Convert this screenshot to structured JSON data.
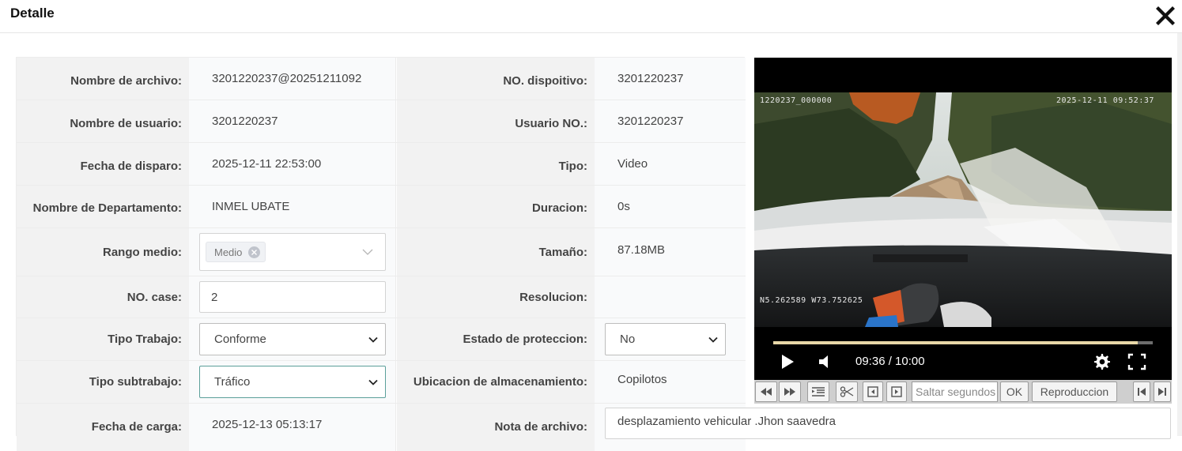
{
  "dialog": {
    "title": "Detalle"
  },
  "fields": {
    "nombre_archivo": {
      "label": "Nombre de archivo:",
      "value": "3201220237@20251211092"
    },
    "no_dispositivo": {
      "label": "NO. dispoitivo:",
      "value": "3201220237"
    },
    "nombre_usuario": {
      "label": "Nombre de usuario:",
      "value": "3201220237"
    },
    "usuario_no": {
      "label": "Usuario NO.:",
      "value": "3201220237"
    },
    "fecha_disparo": {
      "label": "Fecha de disparo:",
      "value": "2025-12-11 22:53:00"
    },
    "tipo": {
      "label": "Tipo:",
      "value": "Video"
    },
    "departamento": {
      "label": "Nombre de Departamento:",
      "value": "INMEL UBATE"
    },
    "duracion": {
      "label": "Duracion:",
      "value": "0s"
    },
    "rango_medio": {
      "label": "Rango medio:",
      "tag": "Medio"
    },
    "tamano": {
      "label": "Tamaño:",
      "value": "87.18MB"
    },
    "no_case": {
      "label": "NO. case:",
      "value": "2"
    },
    "resolucion": {
      "label": "Resolucion:",
      "value": ""
    },
    "tipo_trabajo": {
      "label": "Tipo Trabajo:",
      "value": "Conforme"
    },
    "estado_proteccion": {
      "label": "Estado de proteccion:",
      "value": "No"
    },
    "tipo_subtrabajo": {
      "label": "Tipo subtrabajo:",
      "value": "Tráfico"
    },
    "ubicacion": {
      "label": "Ubicacion de almacenamiento:",
      "value": "Copilotos"
    },
    "fecha_carga": {
      "label": "Fecha de carga:",
      "value": "2025-12-13 05:13:17"
    },
    "nota_archivo": {
      "label": "Nota de archivo:",
      "value": "desplazamiento vehicular .Jhon saavedra"
    }
  },
  "player": {
    "osd_device": "1220237_000000",
    "osd_timestamp": "2025-12-11  09:52:37",
    "osd_gps": "N5.262589  W73.752625",
    "time_display": "09:36 / 10:00",
    "progress_fraction": 0.96,
    "controls": [
      "play-icon",
      "volume-icon",
      "settings-gear-icon",
      "fullscreen-icon"
    ]
  },
  "toolbar": {
    "seek_placeholder": "Saltar segundos",
    "ok_label": "OK",
    "playback_label": "Reproduccion",
    "buttons": [
      "rewind-icon",
      "fast-forward-icon",
      "list-icon",
      "scissors-icon",
      "frame-back-icon",
      "frame-forward-icon",
      "skip-start-icon",
      "skip-end-icon"
    ]
  },
  "colors": {
    "label_bg": "#f2f2f2",
    "value_bg": "#f9fafb",
    "border": "#ececec",
    "player_bg": "#000000"
  }
}
